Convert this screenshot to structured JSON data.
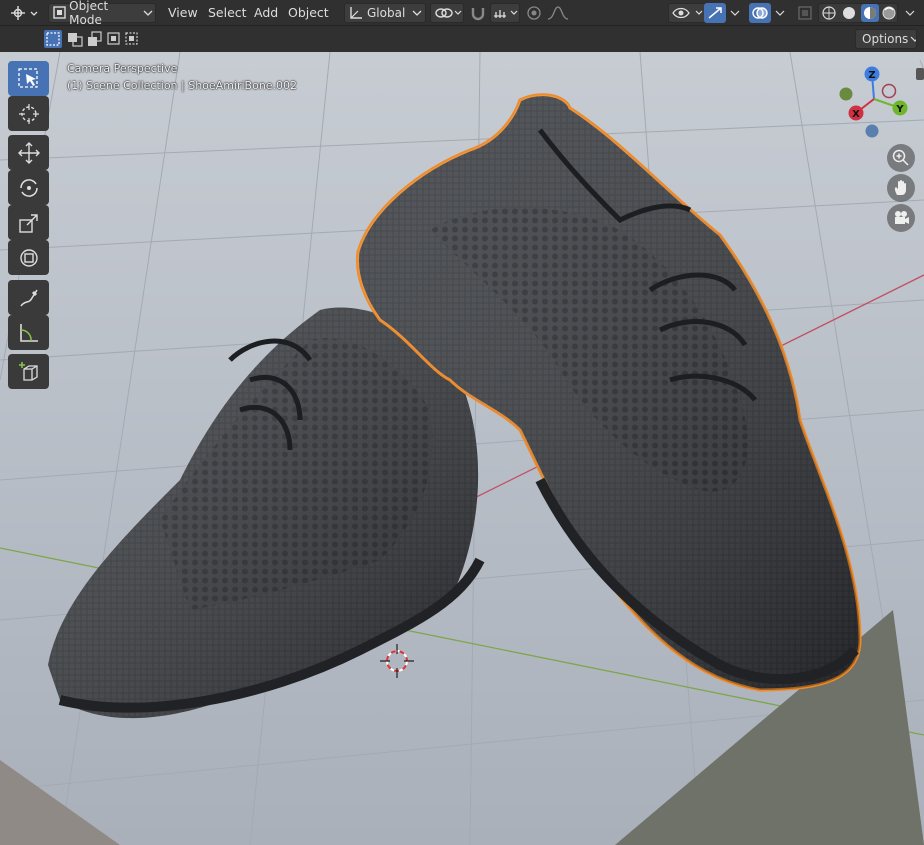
{
  "header": {
    "mode_label": "Object Mode",
    "menus": [
      "View",
      "Select",
      "Add",
      "Object"
    ],
    "transform_orientation": "Global",
    "options_label": "Options"
  },
  "viewport": {
    "view_name": "Camera Perspective",
    "collection_info": "(1) Scene Collection | ShoeAmiriBone.002"
  },
  "gizmo": {
    "z": "Z",
    "y": "Y",
    "x": "X"
  },
  "colors": {
    "accent": "#4772b3",
    "selection_outline": "#f08a26",
    "axis_x": "#d03040",
    "axis_y": "#6db52a",
    "axis_z": "#3d7de0"
  },
  "icons": {
    "tools": [
      "select-box-icon",
      "cursor-icon",
      "move-icon",
      "rotate-icon",
      "scale-icon",
      "transform-icon",
      "annotate-icon",
      "measure-icon",
      "add-cube-icon"
    ],
    "nav": [
      "zoom-icon",
      "pan-hand-icon",
      "camera-view-icon"
    ]
  }
}
